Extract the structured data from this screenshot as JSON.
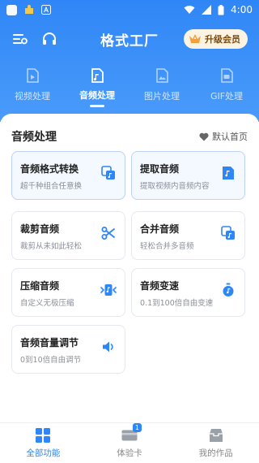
{
  "status_bar": {
    "time": "4:00"
  },
  "app_bar": {
    "title": "格式工厂",
    "vip_label": "升级会员"
  },
  "tabs": [
    {
      "label": "视频处理",
      "icon": "video-file-icon"
    },
    {
      "label": "音频处理",
      "icon": "audio-file-icon",
      "active": true
    },
    {
      "label": "图片处理",
      "icon": "image-file-icon"
    },
    {
      "label": "GIF处理",
      "icon": "gif-file-icon"
    }
  ],
  "section": {
    "title": "音频处理",
    "default_home_label": "默认首页"
  },
  "cards": [
    {
      "title": "音频格式转换",
      "subtitle": "超千种组合任意换",
      "icon": "audio-convert-icon"
    },
    {
      "title": "提取音频",
      "subtitle": "提取视频内音频内容",
      "icon": "extract-audio-icon"
    },
    {
      "title": "裁剪音频",
      "subtitle": "裁剪从未如此轻松",
      "icon": "scissors-icon"
    },
    {
      "title": "合并音频",
      "subtitle": "轻松合并多音频",
      "icon": "merge-icon"
    },
    {
      "title": "压缩音频",
      "subtitle": "自定义无极压缩",
      "icon": "compress-icon"
    },
    {
      "title": "音频变速",
      "subtitle": "0.1到100倍自由变速",
      "icon": "stopwatch-icon"
    },
    {
      "title": "音频音量调节",
      "subtitle": "0到10倍自由调节",
      "icon": "volume-icon"
    }
  ],
  "bottom_nav": [
    {
      "label": "全部功能",
      "icon": "grid-icon",
      "active": true
    },
    {
      "label": "体验卡",
      "icon": "card-icon",
      "badge": "1"
    },
    {
      "label": "我的作品",
      "icon": "box-icon"
    }
  ],
  "colors": {
    "primary": "#2f86f6",
    "vip_bg": "#fdf3e2"
  }
}
